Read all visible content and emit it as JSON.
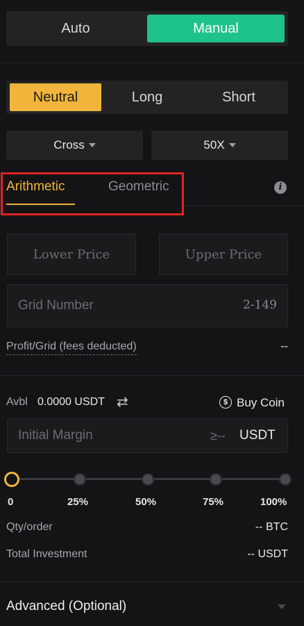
{
  "mode_toggle": {
    "auto": "Auto",
    "manual": "Manual"
  },
  "direction": {
    "neutral": "Neutral",
    "long": "Long",
    "short": "Short"
  },
  "dropdowns": {
    "margin_mode": "Cross",
    "leverage": "50X"
  },
  "grid_type": {
    "arithmetic": "Arithmetic",
    "geometric": "Geometric"
  },
  "inputs": {
    "lower_price": "Lower Price",
    "upper_price": "Upper Price",
    "grid_number": "Grid Number",
    "grid_range": "2-149"
  },
  "profit_grid": {
    "label": "Profit/Grid (fees deducted)",
    "value": "--"
  },
  "balance": {
    "label": "Avbl",
    "value": "0.0000 USDT",
    "buy_coin": "Buy Coin"
  },
  "margin": {
    "placeholder": "Initial Margin",
    "min": "≥--",
    "unit": "USDT"
  },
  "slider": {
    "value_percent": 0,
    "marks": [
      "0",
      "25%",
      "50%",
      "75%",
      "100%"
    ]
  },
  "qty": {
    "label": "Qty/order",
    "value": "-- BTC"
  },
  "investment": {
    "label": "Total Investment",
    "value": "-- USDT"
  },
  "advanced": {
    "label": "Advanced (Optional)"
  },
  "colors": {
    "accent_green": "#1ec28b",
    "accent_yellow": "#f0b53a",
    "highlight_red": "#e02424"
  }
}
